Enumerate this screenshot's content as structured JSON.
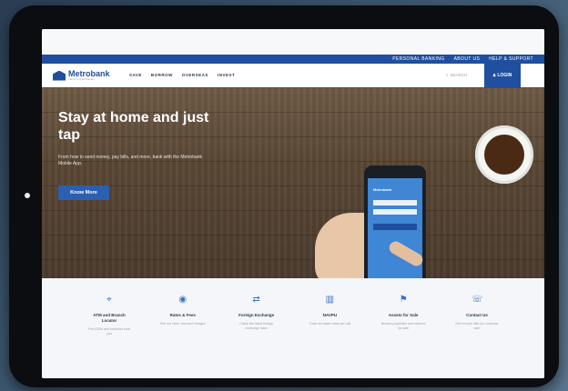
{
  "util_nav": [
    "PERSONAL BANKING",
    "ABOUT US",
    "HELP & SUPPORT"
  ],
  "logo": {
    "name": "Metrobank",
    "tagline": "You're in good hands"
  },
  "main_nav": [
    "SAVE",
    "BORROW",
    "OVERSEAS",
    "INVEST"
  ],
  "search_label": "SEARCH",
  "login_label": "LOGIN",
  "hero": {
    "title": "Stay at home and just tap",
    "subtitle": "From how to send money, pay bills, and more, bank with the Metrobank Mobile App.",
    "cta": "Know More"
  },
  "phone": {
    "brand": "Metrobank"
  },
  "features": [
    {
      "title": "ATM and Branch Locator",
      "desc": "Find ATMs and branches near you",
      "icon": "location-icon"
    },
    {
      "title": "Rates & Fees",
      "desc": "See our rates, fees and charges",
      "icon": "rates-icon"
    },
    {
      "title": "Foreign Exchange",
      "desc": "Check the latest foreign exchange rates",
      "icon": "exchange-icon"
    },
    {
      "title": "NAVPU",
      "desc": "Track net asset value per unit",
      "icon": "chart-icon"
    },
    {
      "title": "Assets for Sale",
      "desc": "Browse properties and vehicles for sale",
      "icon": "assets-icon"
    },
    {
      "title": "Contact Us",
      "desc": "Get in touch with our customer care",
      "icon": "contact-icon"
    }
  ],
  "colors": {
    "brand_blue": "#1f4f9e",
    "accent_blue": "#2b5fb0"
  }
}
